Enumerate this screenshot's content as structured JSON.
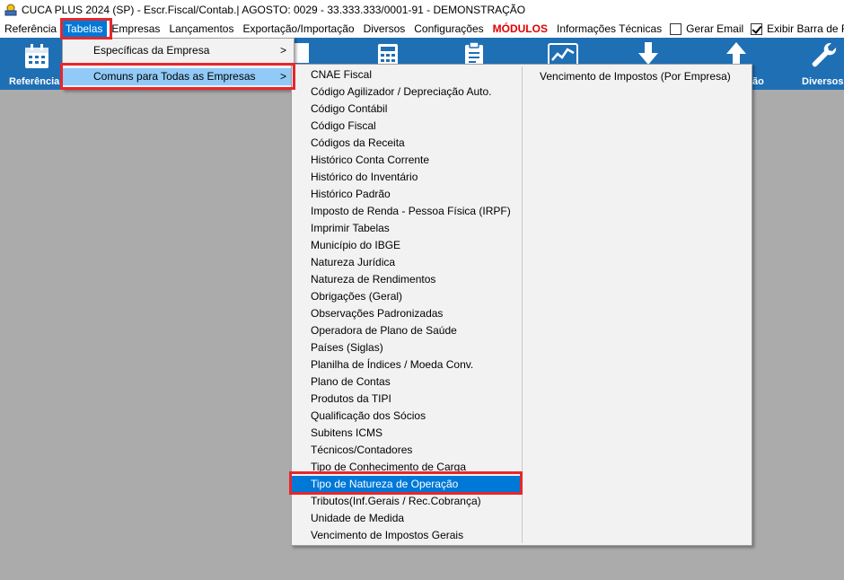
{
  "window": {
    "title": "CUCA PLUS 2024 (SP) - Escr.Fiscal/Contab.| AGOSTO: 0029 - 33.333.333/0001-91 - DEMONSTRAÇÃO"
  },
  "menubar": {
    "items": [
      "Referência",
      "Tabelas",
      "Empresas",
      "Lançamentos",
      "Exportação/Importação",
      "Diversos",
      "Configurações"
    ],
    "modules": "MÓDULOS",
    "info": "Informações Técnicas",
    "gerar_email": "Gerar Email",
    "exibir_barra": "Exibir Barra de F"
  },
  "toolbar": {
    "referencia": "Referência",
    "exportacao_partial": "ão",
    "diversos": "Diversos"
  },
  "tabelas_menu": {
    "items": [
      {
        "label": "Específicas da Empresa",
        "arrow": ">"
      },
      {
        "label": "Comuns para Todas as Empresas",
        "arrow": ">"
      }
    ]
  },
  "comuns_menu": {
    "items": [
      "CNAE Fiscal",
      "Código Agilizador / Depreciação Auto.",
      "Código Contábil",
      "Código Fiscal",
      "Códigos da Receita",
      "Histórico Conta Corrente",
      "Histórico do Inventário",
      "Histórico Padrão",
      "Imposto de Renda - Pessoa Física (IRPF)",
      "Imprimir Tabelas",
      "Município do IBGE",
      "Natureza Jurídica",
      "Natureza de Rendimentos",
      "Obrigações (Geral)",
      "Observações Padronizadas",
      "Operadora de Plano de Saúde",
      "Países (Siglas)",
      "Planilha de Índices / Moeda Conv.",
      "Plano de Contas",
      "Produtos da TIPI",
      "Qualificação dos Sócios",
      "Subitens ICMS",
      "Técnicos/Contadores",
      "Tipo de Conhecimento de Carga",
      "Tipo de Natureza de Operação",
      "Tributos(Inf.Gerais / Rec.Cobrança)",
      "Unidade de Medida",
      "Vencimento de Impostos Gerais"
    ],
    "second_column": [
      "Vencimento de Impostos (Por Empresa)"
    ]
  }
}
